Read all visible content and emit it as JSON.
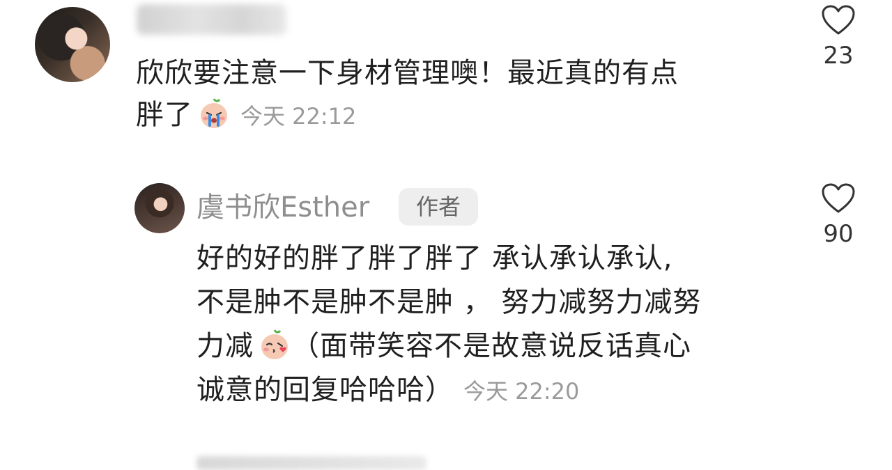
{
  "comment_main": {
    "text_line1": "欣欣要注意一下身材管理噢！最近真的有点",
    "text_line2": "胖了",
    "emoji": "crying-emoji",
    "time": "今天 22:12",
    "like_count": "23"
  },
  "reply": {
    "username": "虞书欣Esther",
    "author_badge": "作者",
    "text_line1": "好的好的胖了胖了胖了 承认承认承认,",
    "text_line2": "不是肿不是肿不是肿 ， 努力减努力减努",
    "text_line3_a": "力减",
    "text_line3_b": "（面带笑容不是故意说反话真心",
    "text_line4": "诚意的回复哈哈哈）",
    "emoji": "kissing-emoji",
    "time": "今天 22:20",
    "like_count": "90"
  },
  "colors": {
    "text": "#1f1f1f",
    "secondary": "#9a9a9a",
    "badge_bg": "#eeeeee"
  }
}
